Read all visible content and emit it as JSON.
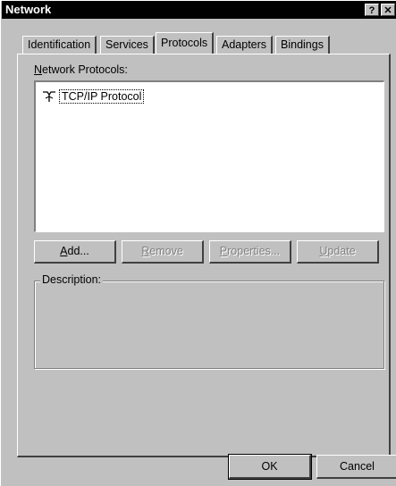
{
  "window": {
    "title": "Network",
    "help_label": "?",
    "close_label": "✕"
  },
  "tabs": [
    {
      "label": "Identification"
    },
    {
      "label": "Services"
    },
    {
      "label": "Protocols"
    },
    {
      "label": "Adapters"
    },
    {
      "label": "Bindings"
    }
  ],
  "protocols": {
    "list_label": "Network Protocols:",
    "items": [
      {
        "label": "TCP/IP Protocol",
        "icon": "network-protocol-icon"
      }
    ]
  },
  "buttons": {
    "add": "Add...",
    "remove": "Remove",
    "properties": "Properties...",
    "update": "Update"
  },
  "description": {
    "label": "Description:"
  },
  "footer": {
    "ok": "OK",
    "cancel": "Cancel"
  }
}
